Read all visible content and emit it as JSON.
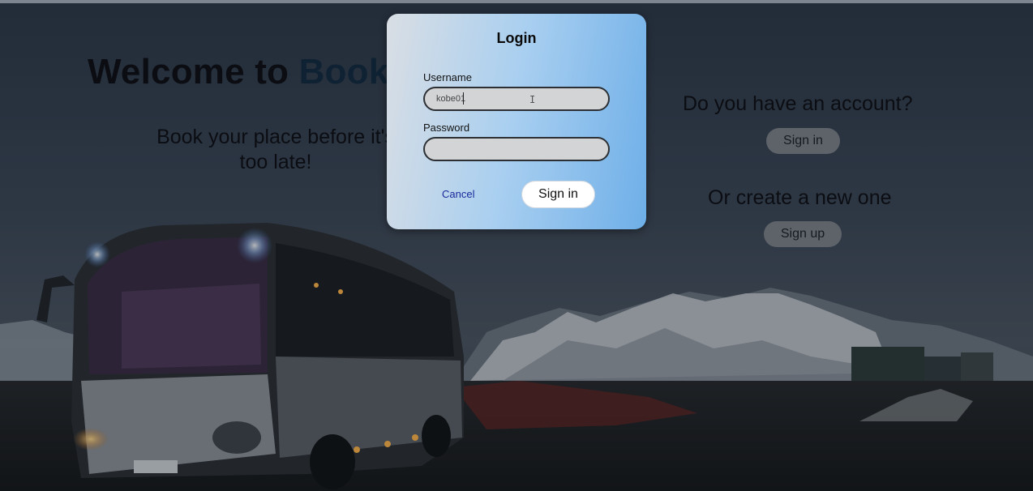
{
  "hero": {
    "welcome_prefix": "Welcome to ",
    "welcome_brand": "Book",
    "tagline": "Book your place before it's too late!"
  },
  "account": {
    "have_account_text": "Do you have an account?",
    "signin_label": "Sign in",
    "create_text": "Or create a new one",
    "signup_label": "Sign up"
  },
  "login_modal": {
    "title": "Login",
    "username_label": "Username",
    "username_value": "kobe01",
    "password_label": "Password",
    "password_value": "",
    "cancel_label": "Cancel",
    "signin_label": "Sign in",
    "cursor_icon": "text-cursor-icon"
  },
  "colors": {
    "modal_gradient_start": "#d9dee4",
    "modal_gradient_end": "#6eafe8",
    "overlay_button": "#5e636a",
    "cancel_link": "#1a2a9a"
  }
}
